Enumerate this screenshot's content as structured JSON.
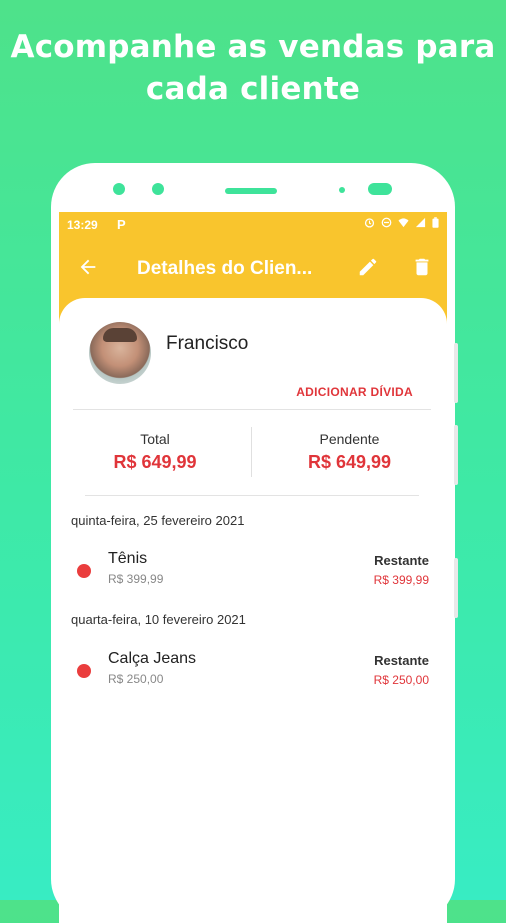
{
  "headline": {
    "line1": "Acompanhe as vendas para",
    "line2": "cada cliente"
  },
  "status_bar": {
    "time": "13:29",
    "app_icon": "P"
  },
  "app_bar": {
    "title": "Detalhes do Clien..."
  },
  "client": {
    "name": "Francisco",
    "add_debt_label": "ADICIONAR DÍVIDA"
  },
  "totals": {
    "total_label": "Total",
    "total_value": "R$ 649,99",
    "pending_label": "Pendente",
    "pending_value": "R$ 649,99"
  },
  "groups": [
    {
      "date": "quinta-feira, 25 fevereiro 2021",
      "items": [
        {
          "name": "Tênis",
          "price": "R$ 399,99",
          "rest_label": "Restante",
          "rest_value": "R$ 399,99"
        }
      ]
    },
    {
      "date": "quarta-feira, 10 fevereiro 2021",
      "items": [
        {
          "name": "Calça Jeans",
          "price": "R$ 250,00",
          "rest_label": "Restante",
          "rest_value": "R$ 250,00"
        }
      ]
    }
  ],
  "colors": {
    "accent": "#f9c52d",
    "danger": "#e0353a",
    "background_top": "#4ee28a",
    "background_bottom": "#38ecc3"
  },
  "icons": [
    "back-arrow-icon",
    "edit-pencil-icon",
    "trash-icon",
    "alarm-icon",
    "dnd-icon",
    "wifi-icon",
    "signal-icon",
    "battery-icon"
  ]
}
